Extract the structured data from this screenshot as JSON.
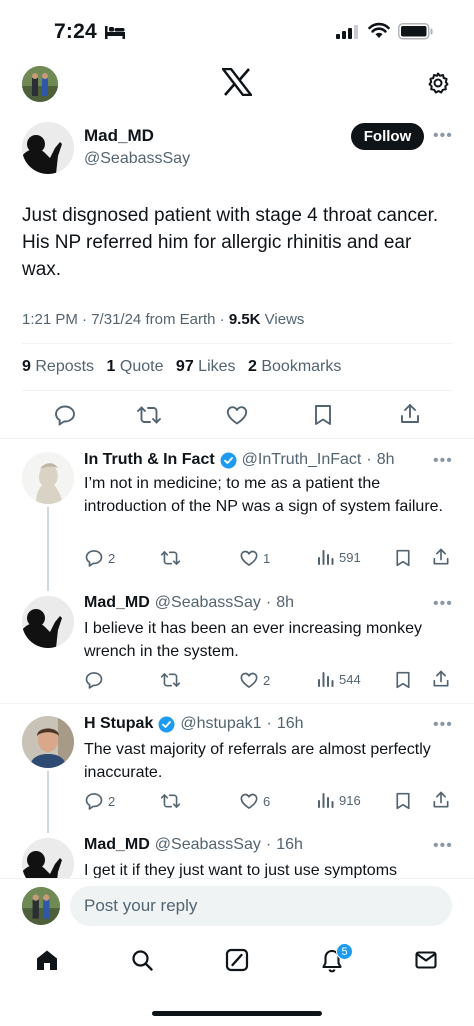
{
  "status_bar": {
    "time": "7:24"
  },
  "main_tweet": {
    "author_name": "Mad_MD",
    "author_handle": "@SeabassSay",
    "follow_label": "Follow",
    "text": "Just disgnosed patient with stage 4 throat cancer.  His NP referred him for allergic rhinitis and ear wax.",
    "time": "1:21 PM",
    "date": "7/31/24",
    "source": "from Earth",
    "views_count": "9.5K",
    "views_label": "Views",
    "reposts_count": "9",
    "reposts_label": "Reposts",
    "quotes_count": "1",
    "quotes_label": "Quote",
    "likes_count": "97",
    "likes_label": "Likes",
    "bookmarks_count": "2",
    "bookmarks_label": "Bookmarks"
  },
  "replies": [
    {
      "name": "In Truth & In Fact",
      "verified": true,
      "handle": "@InTruth_InFact",
      "age": "8h",
      "text": "I’m not in medicine; to me as a patient the introduction of the NP was a sign of system failure.",
      "replies": "2",
      "reposts": "",
      "likes": "1",
      "views": "591"
    },
    {
      "name": "Mad_MD",
      "verified": false,
      "handle": "@SeabassSay",
      "age": "8h",
      "text": "I believe it has been an ever increasing monkey wrench in the system.",
      "replies": "",
      "reposts": "",
      "likes": "2",
      "views": "544"
    },
    {
      "name": "H Stupak",
      "verified": true,
      "handle": "@hstupak1",
      "age": "16h",
      "text": "The vast majority of referrals are almost perfectly inaccurate.",
      "replies": "2",
      "reposts": "",
      "likes": "6",
      "views": "916"
    },
    {
      "name": "Mad_MD",
      "verified": false,
      "handle": "@SeabassSay",
      "age": "16h",
      "text": "I get it if they just want to just use symptoms"
    }
  ],
  "composer": {
    "placeholder": "Post your reply"
  },
  "tab_bar": {
    "notifications_badge": "5"
  },
  "icons": [
    "bed-icon",
    "signal-icon",
    "wifi-icon",
    "battery-icon",
    "x-logo-icon",
    "gear-icon",
    "reply-icon",
    "repost-icon",
    "like-icon",
    "bookmark-icon",
    "share-icon",
    "views-icon",
    "verified-icon",
    "home-icon",
    "search-icon",
    "grok-icon",
    "bell-icon",
    "mail-icon"
  ],
  "colors": {
    "accent": "#1d9bf0",
    "text": "#0f1419",
    "muted": "#536471"
  }
}
